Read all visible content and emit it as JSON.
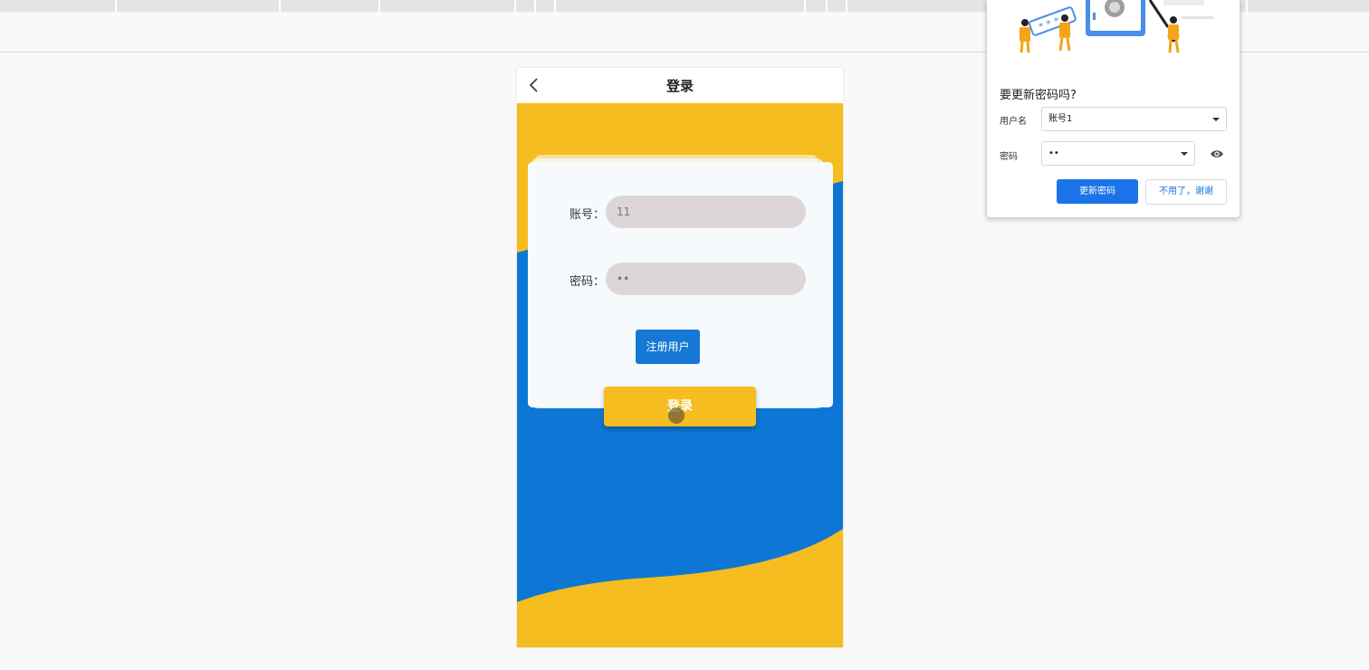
{
  "page": {
    "title": "登录",
    "back_icon": "chevron-left-icon"
  },
  "form": {
    "account_label": "账号：",
    "account_value": "11",
    "password_label": "密码：",
    "password_value": "••",
    "register_label": "注册用户",
    "login_label": "登录"
  },
  "colors": {
    "yellow": "#f5bd1f",
    "blue": "#0e77d5",
    "input_bg": "#ddd6d7"
  },
  "password_prompt": {
    "title": "要更新密码吗?",
    "username_label": "用户名",
    "username_value": "账号1",
    "password_label": "密码",
    "password_value": "••",
    "eye_icon": "eye-icon",
    "update_label": "更新密码",
    "dismiss_label": "不用了，谢谢",
    "illustration_text": "* * * *"
  }
}
